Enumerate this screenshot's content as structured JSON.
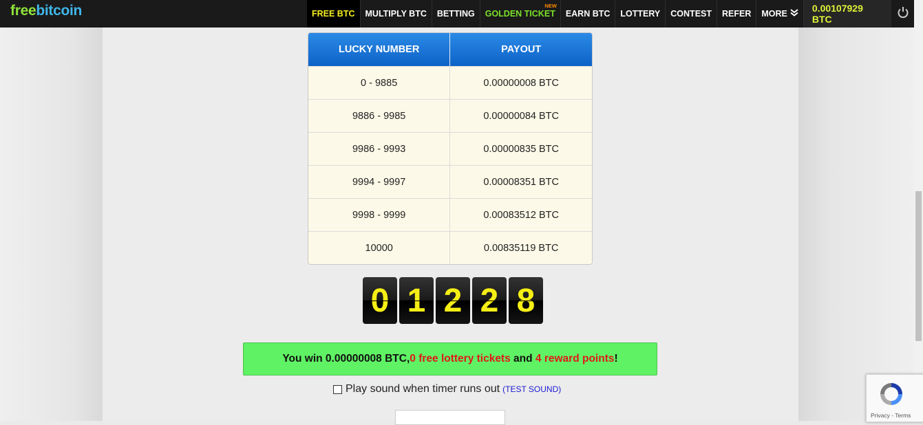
{
  "logo": {
    "part1": "free",
    "part2": "bitcoin"
  },
  "nav": {
    "items": [
      {
        "label": "FREE BTC"
      },
      {
        "label": "MULTIPLY BTC"
      },
      {
        "label": "BETTING"
      },
      {
        "label": "GOLDEN TICKET",
        "badge": "NEW"
      },
      {
        "label": "EARN BTC"
      },
      {
        "label": "LOTTERY"
      },
      {
        "label": "CONTEST"
      },
      {
        "label": "REFER"
      },
      {
        "label": "MORE"
      }
    ],
    "balance": "0.00107929 BTC"
  },
  "payout_table": {
    "headers": [
      "LUCKY NUMBER",
      "PAYOUT"
    ],
    "rows": [
      [
        "0 - 9885",
        "0.00000008 BTC"
      ],
      [
        "9886 - 9985",
        "0.00000084 BTC"
      ],
      [
        "9986 - 9993",
        "0.00000835 BTC"
      ],
      [
        "9994 - 9997",
        "0.00008351 BTC"
      ],
      [
        "9998 - 9999",
        "0.00083512 BTC"
      ],
      [
        "10000",
        "0.00835119 BTC"
      ]
    ]
  },
  "lucky_number": {
    "digits": [
      "0",
      "1",
      "2",
      "2",
      "8"
    ]
  },
  "win_message": {
    "prefix": "You win 0.00000008 BTC, ",
    "tickets": "0 free lottery tickets",
    "middle": " and ",
    "points": "4 reward points",
    "suffix": "!"
  },
  "sound": {
    "label": "Play sound when timer runs out",
    "test_open": "(",
    "test_label": "TEST SOUND",
    "test_close": ")"
  },
  "recaptcha": {
    "privacy": "Privacy",
    "separator": " - ",
    "terms": "Terms"
  },
  "colors": {
    "nav_bg": "#1a1a1a",
    "active_nav": "#f5ef1c",
    "golden_nav": "#7be12a",
    "balance": "#dff23a",
    "table_header": "#0d62c7",
    "win_bg": "#5ff264",
    "highlight_red": "#e01a1a",
    "digit_text": "#f5ee15"
  }
}
